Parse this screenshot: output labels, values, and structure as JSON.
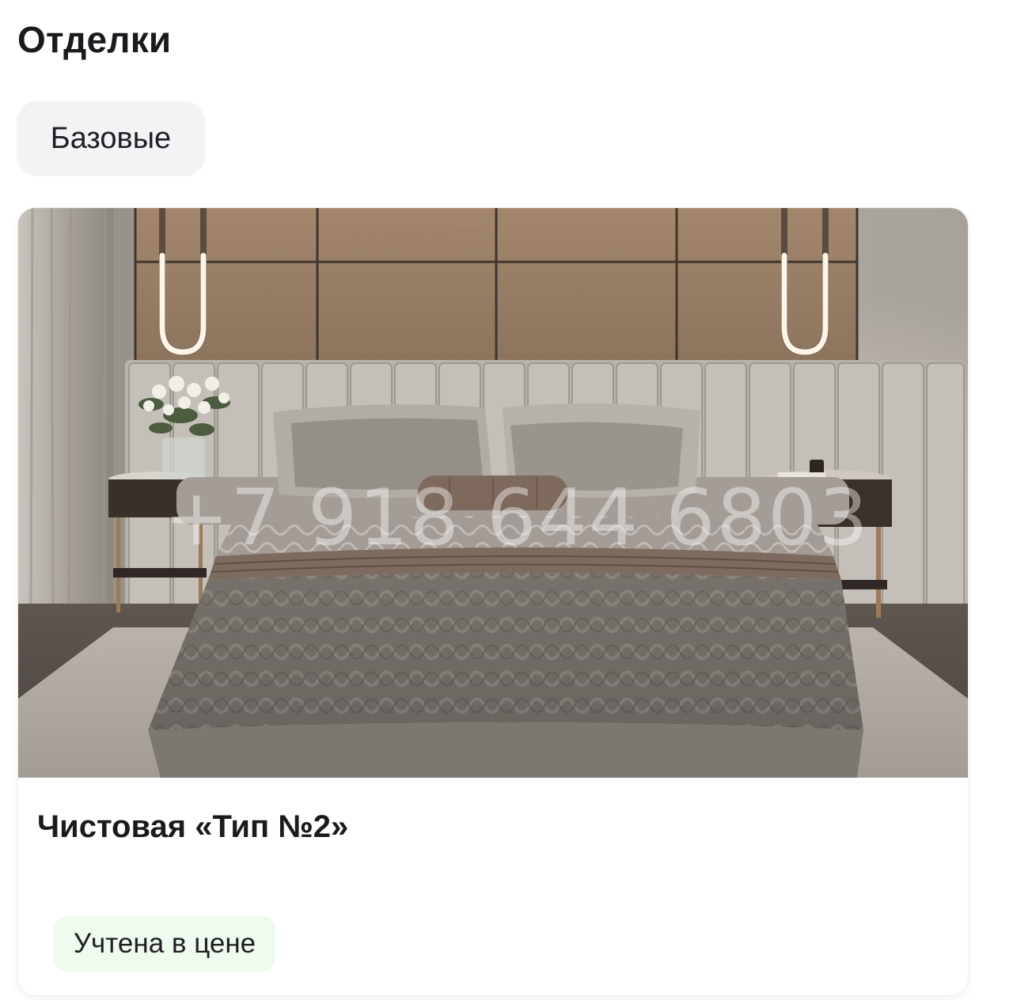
{
  "section": {
    "title": "Отделки"
  },
  "filter_chip": {
    "label": "Базовые"
  },
  "card": {
    "title": "Чистовая «Тип №2»",
    "badge": "Учтена в цене",
    "image": {
      "watermark": "+7 918 644 6803",
      "subject": "bedroom-interior"
    }
  },
  "colors": {
    "chip_bg": "#f3f3f6",
    "badge_bg": "#effbee",
    "text": "#1b1b1f",
    "card_bg": "#ffffff"
  }
}
